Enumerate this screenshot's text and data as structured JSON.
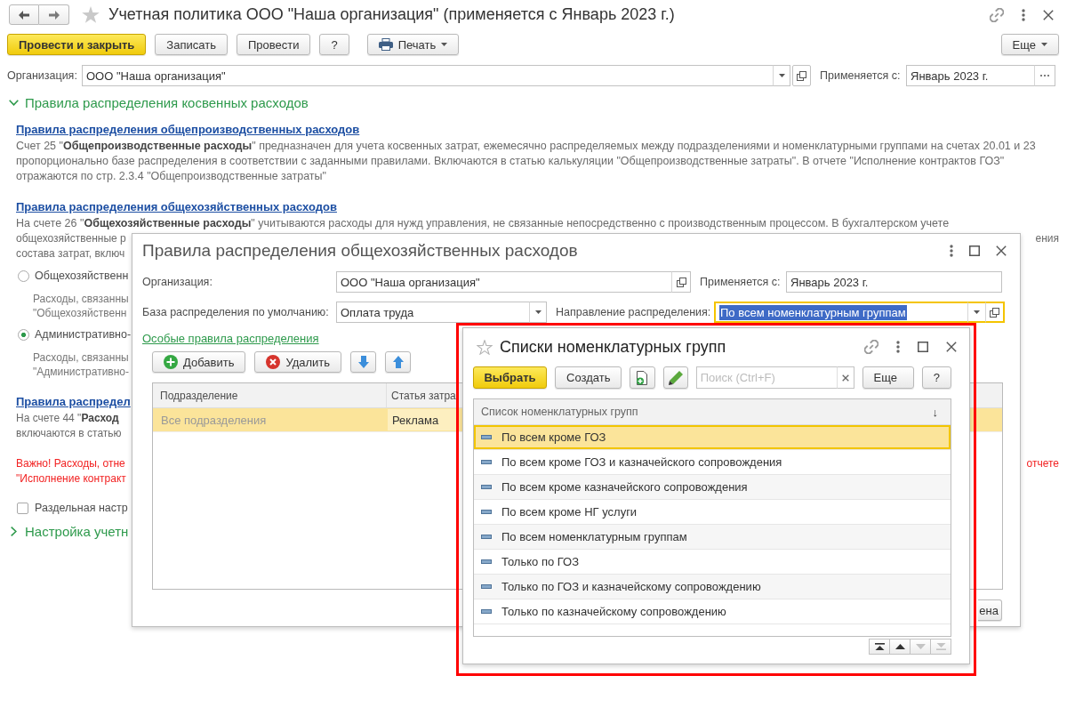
{
  "main_window": {
    "title": "Учетная политика ООО \"Наша организация\" (применяется с Январь 2023 г.)",
    "toolbar": [
      {
        "label": "Провести и закрыть",
        "kind": "primary"
      },
      {
        "label": "Записать",
        "kind": "plain"
      },
      {
        "label": "Провести",
        "kind": "plain"
      },
      {
        "label": "?",
        "kind": "plain"
      },
      {
        "label": "Печать",
        "kind": "print"
      },
      {
        "label": "Еще",
        "kind": "more"
      }
    ],
    "fields": [
      {
        "label": "Организация:",
        "value": "ООО \"Наша организация\"",
        "kind": "combo"
      },
      {
        "label": "Применяется с:",
        "value": "Январь 2023 г.",
        "kind": "choice"
      }
    ],
    "groups": [
      {
        "title": "Правила распределения косвенных расходов",
        "expanded": true,
        "content": [
          {
            "kind": "link",
            "text": "Правила распределения общепроизводственных расходов"
          },
          {
            "kind": "text",
            "text": "Счет 25 \"**Общепроизводственные расходы**\" предназначен для учета косвенных затрат, ежемесячно распределяемых между подразделениями и номенклатурными группами на счетах 20.01 и 23 пропорционально базе распределения в соответствии с заданными правилами. Включаются в статью калькуляции \"Общепроизводственные затраты\". В отчете \"Исполнение контрактов ГОЗ\" отражаются по стр. 2.3.4 \"Общепроизводственные затраты\""
          },
          {
            "kind": "link",
            "text": "Правила распределения общехозяйственных расходов"
          },
          {
            "kind": "text",
            "text": "На счете 26 \"**Общехозяйственные расходы**\" учитываются расходы для нужд управления, не связанные непосредственно с производственным процессом. В бухгалтерском учете"
          },
          {
            "kind": "text",
            "lines": [
              {
                "text": "общехозяйственные р",
                "right": "ения"
              },
              {
                "text": "состава затрат, включ"
              }
            ]
          },
          {
            "kind": "radio",
            "label": "Общехозяйственн",
            "selected": false,
            "lines": [
              {
                "text": "Расходы, связанны"
              },
              {
                "text": "\"Общехозяйственн"
              }
            ]
          },
          {
            "kind": "radio",
            "label": "Административно-",
            "selected": true,
            "lines": [
              {
                "text": "Расходы, связанны"
              },
              {
                "text": "\"Административно-"
              }
            ]
          },
          {
            "kind": "link",
            "text": "Правила распредел"
          },
          {
            "kind": "text",
            "lines": [
              {
                "text": "На счете 44 \"**Расход**"
              },
              {
                "text": "включаются в статью"
              }
            ]
          },
          {
            "kind": "warning",
            "lines": [
              {
                "text": "Важно! Расходы, отне",
                "right": "отчете"
              },
              {
                "text": "\"Исполнение контракт"
              }
            ]
          },
          {
            "kind": "checkbox",
            "label": "Раздельная настр",
            "checked": false
          }
        ]
      },
      {
        "title": "Настройка учетн",
        "expanded": false
      }
    ]
  },
  "rules_dialog": {
    "title": "Правила распределения общехозяйственных расходов",
    "fields": [
      {
        "label": "Организация:",
        "value": "ООО \"Наша организация\"",
        "kind": "link",
        "focused": false
      },
      {
        "label": "Применяется с:",
        "value": "Январь 2023 г.",
        "kind": "plain",
        "focused": false
      },
      {
        "label": "База распределения по умолчанию:",
        "value": "Оплата труда",
        "kind": "select",
        "focused": false
      },
      {
        "label": "Направление распределения:",
        "value": "По всем номенклатурным группам",
        "kind": "combolink",
        "focused": true
      }
    ],
    "special_rules_link": "Особые правила распределения",
    "table_toolbar": [
      {
        "label": "Добавить",
        "kind": "add"
      },
      {
        "label": "Удалить",
        "kind": "delete"
      },
      {
        "kind": "down"
      },
      {
        "kind": "up"
      }
    ],
    "table": {
      "columns": [
        "Подразделение",
        "Статья затра"
      ],
      "rows": [
        {
          "cells": [
            "Все подразделения",
            "Реклама"
          ],
          "selected": true
        }
      ]
    },
    "footer_button": "ена"
  },
  "groups_dialog": {
    "title": "Списки номенклатурных групп",
    "toolbar": [
      {
        "label": "Выбрать",
        "kind": "primary"
      },
      {
        "label": "Создать",
        "kind": "plain"
      },
      {
        "kind": "copy"
      },
      {
        "kind": "edit"
      },
      {
        "kind": "search",
        "placeholder": "Поиск (Ctrl+F)"
      },
      {
        "label": "Еще",
        "kind": "more"
      },
      {
        "label": "?",
        "kind": "plain"
      }
    ],
    "list": {
      "column": "Список номенклатурных групп",
      "sort_mark": "↓",
      "items": [
        {
          "label": "По всем кроме ГОЗ",
          "selected": true
        },
        {
          "label": "По всем кроме ГОЗ и казначейского сопровождения",
          "selected": false
        },
        {
          "label": "По всем кроме казначейского сопровождения",
          "selected": false
        },
        {
          "label": "По всем кроме НГ услуги",
          "selected": false
        },
        {
          "label": "По всем номенклатурным группам",
          "selected": false
        },
        {
          "label": "Только по ГОЗ",
          "selected": false
        },
        {
          "label": "Только по ГОЗ и казначейскому сопровождению",
          "selected": false
        },
        {
          "label": "Только по казначейскому сопровождению",
          "selected": false
        }
      ]
    },
    "navigation": [
      {
        "kind": "first",
        "disabled": false
      },
      {
        "kind": "up",
        "disabled": false
      },
      {
        "kind": "down",
        "disabled": true
      },
      {
        "kind": "last",
        "disabled": true
      }
    ]
  }
}
